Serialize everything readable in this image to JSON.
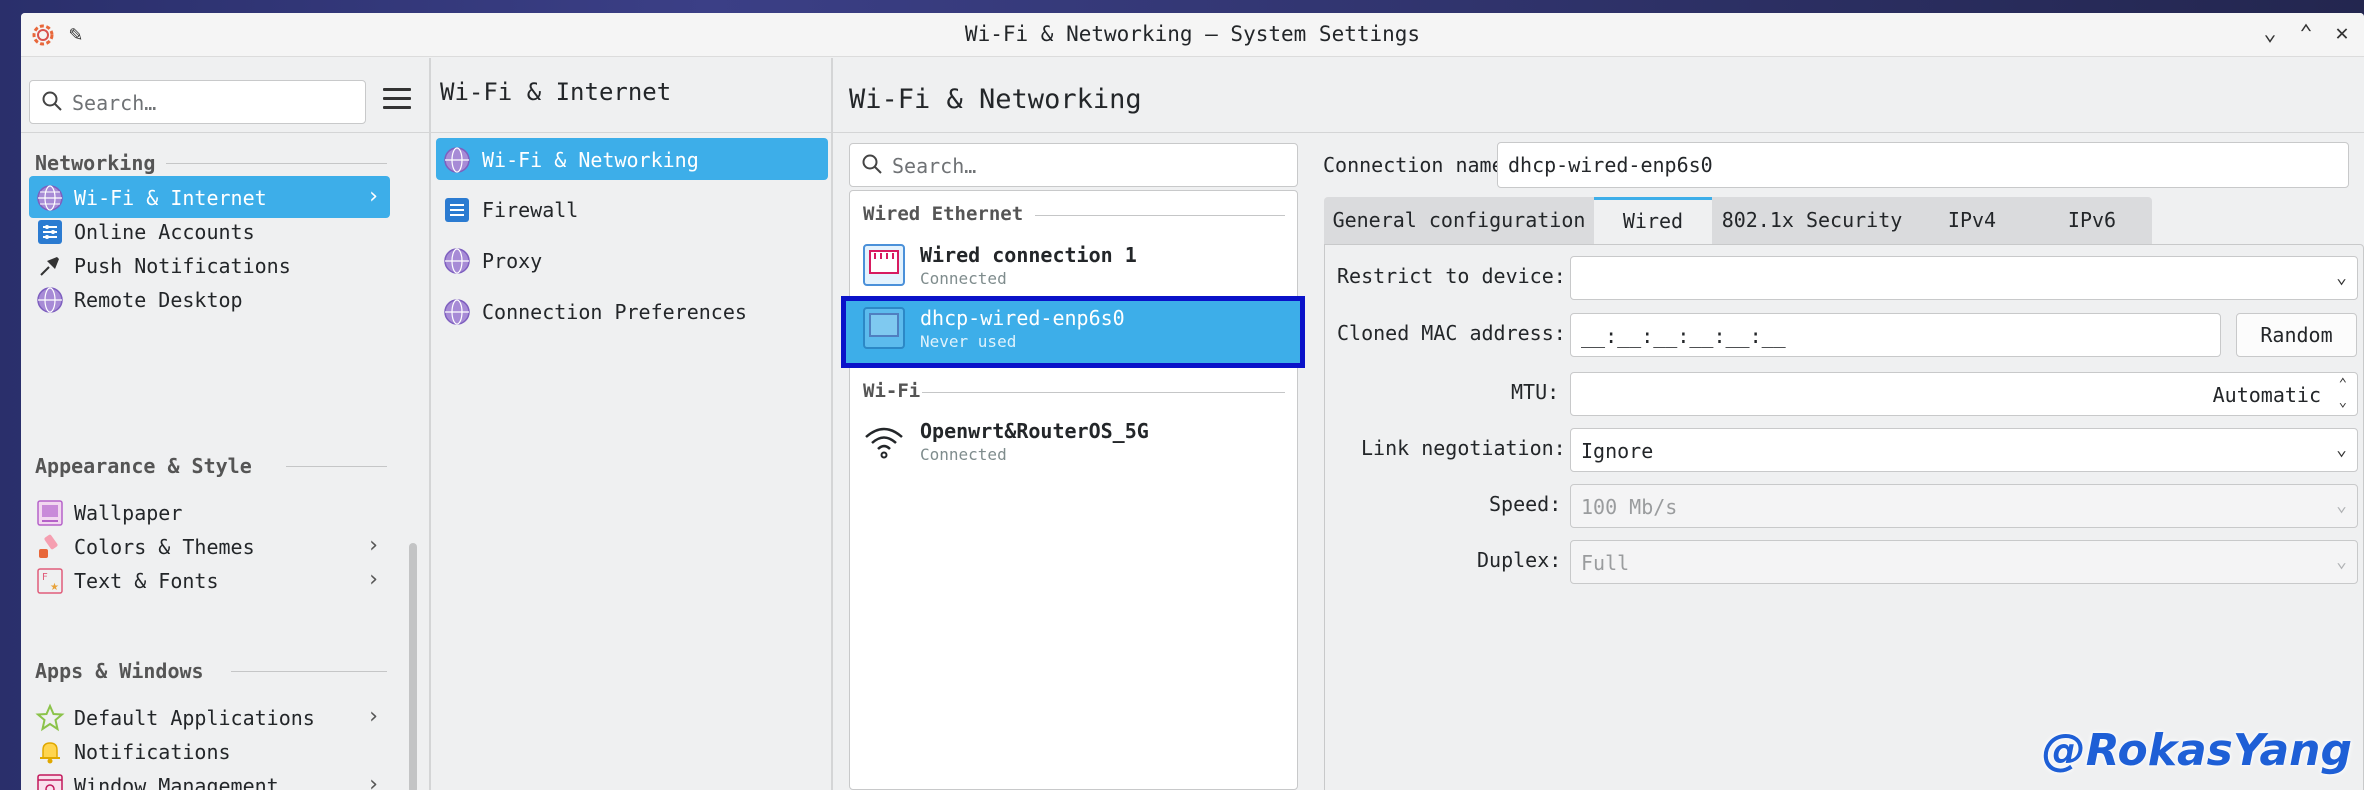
{
  "window": {
    "title": "Wi-Fi & Networking — System Settings"
  },
  "sidebar": {
    "search_placeholder": "Search…",
    "sections": [
      {
        "label": "Networking"
      },
      {
        "label": "Appearance & Style"
      },
      {
        "label": "Apps & Windows"
      }
    ],
    "items": [
      {
        "label": "Wi-Fi & Internet",
        "icon": "globe-icon",
        "selected": true,
        "has_chevron": true
      },
      {
        "label": "Online Accounts",
        "icon": "online-accounts-icon"
      },
      {
        "label": "Push Notifications",
        "icon": "pin-icon"
      },
      {
        "label": "Remote Desktop",
        "icon": "globe-icon"
      },
      {
        "label": "Wallpaper",
        "icon": "wallpaper-icon"
      },
      {
        "label": "Colors & Themes",
        "icon": "paintbrush-icon",
        "has_chevron": true
      },
      {
        "label": "Text & Fonts",
        "icon": "fonts-icon",
        "has_chevron": true
      },
      {
        "label": "Default Applications",
        "icon": "star-icon",
        "has_chevron": true
      },
      {
        "label": "Notifications",
        "icon": "bell-icon"
      },
      {
        "label": "Window Management",
        "icon": "window-icon",
        "has_chevron": true
      }
    ]
  },
  "subpage": {
    "title": "Wi-Fi & Internet",
    "items": [
      {
        "label": "Wi-Fi & Networking",
        "icon": "globe-icon",
        "selected": true
      },
      {
        "label": "Firewall",
        "icon": "firewall-icon"
      },
      {
        "label": "Proxy",
        "icon": "globe-icon"
      },
      {
        "label": "Connection Preferences",
        "icon": "globe-icon"
      }
    ]
  },
  "main": {
    "title": "Wi-Fi & Networking",
    "search_placeholder": "Search…",
    "groups": [
      {
        "label": "Wired Ethernet"
      },
      {
        "label": "Wi-Fi"
      }
    ],
    "connections": [
      {
        "name": "Wired connection 1",
        "status": "Connected",
        "icon": "ethernet-icon"
      },
      {
        "name": "dhcp-wired-enp6s0",
        "status": "Never used",
        "icon": "ethernet-icon",
        "selected": true
      },
      {
        "name": "Openwrt&RouterOS_5G",
        "status": "Connected",
        "icon": "wifi-icon"
      }
    ],
    "details": {
      "connection_name_label": "Connection name:",
      "connection_name_value": "dhcp-wired-enp6s0",
      "tabs": [
        "General configuration",
        "Wired",
        "802.1x Security",
        "IPv4",
        "IPv6"
      ],
      "active_tab": "Wired",
      "restrict_label": "Restrict to device:",
      "restrict_value": "",
      "mac_label": "Cloned MAC address:",
      "mac_value": "__:__:__:__:__:__",
      "random_button": "Random",
      "mtu_label": "MTU:",
      "mtu_value": "Automatic",
      "link_label": "Link negotiation:",
      "link_value": "Ignore",
      "speed_label": "Speed:",
      "speed_value": "100 Mb/s",
      "duplex_label": "Duplex:",
      "duplex_value": "Full"
    }
  },
  "watermark": "@RokasYang",
  "colors": {
    "accent": "#3daee9",
    "selection_outline": "#0a12c9"
  }
}
